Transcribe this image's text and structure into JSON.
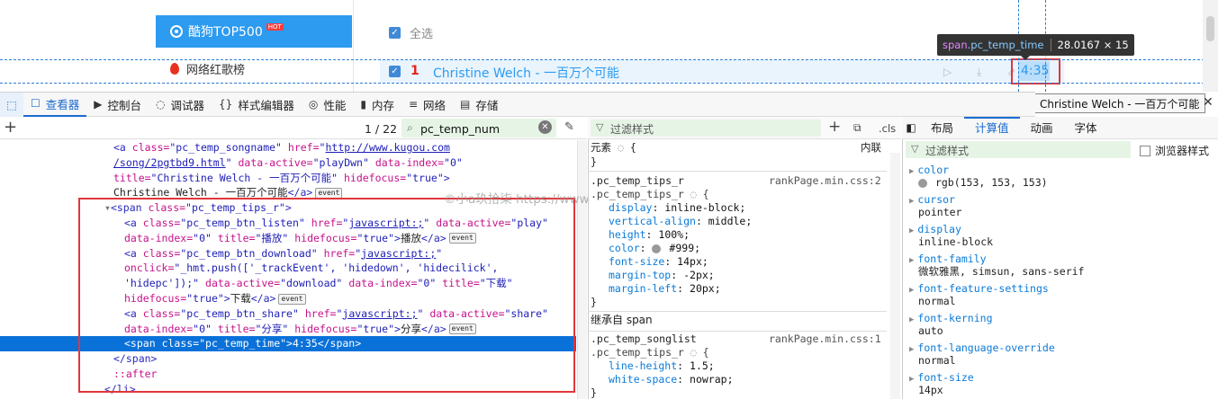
{
  "page": {
    "top500_label": "酷狗TOP500",
    "hot_badge": "HOT",
    "hotsong_label": "网络红歌榜",
    "select_all": "全选",
    "row1_num": "1",
    "row1_name": "Christine Welch - 一百万个可能",
    "row1_icons": "▷ ⤓ ⇗",
    "row1_time": "4:35",
    "tooltip_tag": "span",
    "tooltip_class": ".pc_temp_time",
    "tooltip_size": "28.0167 × 15",
    "title_tooltip": "Christine Welch - 一百万个可能",
    "close": "✕"
  },
  "toolbar": {
    "tabs": [
      {
        "icon": "☐",
        "label": "查看器"
      },
      {
        "icon": "▶",
        "label": "控制台"
      },
      {
        "icon": "◌",
        "label": "调试器"
      },
      {
        "icon": "{}",
        "label": "样式编辑器"
      },
      {
        "icon": "◎",
        "label": "性能"
      },
      {
        "icon": "▮",
        "label": "内存"
      },
      {
        "icon": "≡",
        "label": "网络"
      },
      {
        "icon": "▤",
        "label": "存储"
      }
    ]
  },
  "inspector": {
    "match_count": "1 / 22",
    "search_value": "pc_temp_num",
    "markup_lines": [
      {
        "indent": 126,
        "html": "<span class='t'>&lt;a</span> <span class='a'>class=</span><span class='v'>\"pc_temp_songname\"</span> <span class='a'>href=</span><span class='v'>\"</span><span class='u'>http://www.kugou.com</span>"
      },
      {
        "indent": 126,
        "html": "<span class='u'>/song/2pgtbd9.html</span><span class='v'>\"</span> <span class='a'>data-active=</span><span class='v'>\"playDwn\"</span> <span class='a'>data-index=</span><span class='v'>\"0\"</span>"
      },
      {
        "indent": 126,
        "html": "<span class='a'>title=</span><span class='v'>\"Christine Welch - 一百万个可能\"</span> <span class='a'>hidefocus=</span><span class='v'>\"true\"</span><span class='t'>&gt;</span>"
      },
      {
        "indent": 126,
        "html": "Christine Welch - 一百万个可能<span class='t'>&lt;/a&gt;</span><span class='ev'>event</span>"
      },
      {
        "indent": 116,
        "html": "<span style='color:#777'>▾</span><span class='t'>&lt;span</span> <span class='a'>class=</span><span class='v'>\"pc_temp_tips_r\"</span><span class='t'>&gt;</span>"
      },
      {
        "indent": 138,
        "html": "<span class='t'>&lt;a</span> <span class='a'>class=</span><span class='v'>\"pc_temp_btn_listen\"</span> <span class='a'>href=</span><span class='v'>\"</span><span class='u'>javascript:;</span><span class='v'>\"</span> <span class='a'>data-active=</span><span class='v'>\"play\"</span>"
      },
      {
        "indent": 138,
        "html": "<span class='a'>data-index=</span><span class='v'>\"0\"</span> <span class='a'>title=</span><span class='v'>\"播放\"</span> <span class='a'>hidefocus=</span><span class='v'>\"true\"</span><span class='t'>&gt;</span>播放<span class='t'>&lt;/a&gt;</span><span class='ev'>event</span>"
      },
      {
        "indent": 138,
        "html": "<span class='t'>&lt;a</span> <span class='a'>class=</span><span class='v'>\"pc_temp_btn_download\"</span> <span class='a'>href=</span><span class='v'>\"</span><span class='u'>javascript:;</span><span class='v'>\"</span>"
      },
      {
        "indent": 138,
        "html": "<span class='a'>onclick=</span><span class='v'>\"_hmt.push(['_trackEvent', 'hidedown', 'hidecilick',</span>"
      },
      {
        "indent": 138,
        "html": "<span class='v'>'hidepc']);\"</span> <span class='a'>data-active=</span><span class='v'>\"download\"</span> <span class='a'>data-index=</span><span class='v'>\"0\"</span> <span class='a'>title=</span><span class='v'>\"下载\"</span>"
      },
      {
        "indent": 138,
        "html": "<span class='a'>hidefocus=</span><span class='v'>\"true\"</span><span class='t'>&gt;</span>下载<span class='t'>&lt;/a&gt;</span><span class='ev'>event</span>"
      },
      {
        "indent": 138,
        "html": "<span class='t'>&lt;a</span> <span class='a'>class=</span><span class='v'>\"pc_temp_btn_share\"</span> <span class='a'>href=</span><span class='v'>\"</span><span class='u'>javascript:;</span><span class='v'>\"</span> <span class='a'>data-active=</span><span class='v'>\"share\"</span>"
      },
      {
        "indent": 138,
        "html": "<span class='a'>data-index=</span><span class='v'>\"0\"</span> <span class='a'>title=</span><span class='v'>\"分享\"</span> <span class='a'>hidefocus=</span><span class='v'>\"true\"</span><span class='t'>&gt;</span>分享<span class='t'>&lt;/a&gt;</span><span class='ev'>event</span>"
      },
      {
        "indent": 138,
        "selected": true,
        "html": "<span class='t'>&lt;span</span> <span class='a'>class=</span><span class='v'>\"pc_temp_time\"</span><span class='t'>&gt;</span>4:35<span class='t'>&lt;/span&gt;</span>"
      },
      {
        "indent": 126,
        "html": "<span class='t'>&lt;/span&gt;</span>"
      },
      {
        "indent": 126,
        "html": "<span class='a'>::after</span>"
      },
      {
        "indent": 116,
        "html": "<span class='t'>&lt;/li&gt;</span>"
      }
    ],
    "watermark": "©小a玖拾柒 https://www.cnblogs.com/ftl1012"
  },
  "rules": {
    "filter_placeholder": "过滤样式",
    "cls": ".cls",
    "element_label": "元素",
    "element_brace": "{",
    "inline_label": "内联",
    "close_brace": "}",
    "rule1_selector": ".pc_temp_tips_r",
    "rule1_src": "rankPage.min.css:2",
    "rule1_sub": ".pc_temp_tips_r",
    "rule1_props": [
      {
        "p": "display",
        "v": "inline-block;"
      },
      {
        "p": "vertical-align",
        "v": "middle;"
      },
      {
        "p": "height",
        "v": "100%;"
      },
      {
        "p": "color",
        "v": "#999;",
        "swatch": "#999999"
      },
      {
        "p": "font-size",
        "v": "14px;"
      },
      {
        "p": "margin-top",
        "v": "-2px;"
      },
      {
        "p": "margin-left",
        "v": "20px;"
      }
    ],
    "inherit_label": "继承自 span",
    "rule2_selector": ".pc_temp_songlist",
    "rule2_src": "rankPage.min.css:1",
    "rule2_sub": ".pc_temp_tips_r",
    "rule2_props": [
      {
        "p": "line-height",
        "v": "1.5;"
      },
      {
        "p": "white-space",
        "v": "nowrap;"
      }
    ]
  },
  "computed": {
    "tabs": [
      "布局",
      "计算值",
      "动画",
      "字体"
    ],
    "selected_tab": "计算值",
    "filter_placeholder": "过滤样式",
    "browser_styles": "浏览器样式",
    "props": [
      {
        "p": "color",
        "v": "rgb(153, 153, 153)",
        "swatch": "#999999"
      },
      {
        "p": "cursor",
        "v": "pointer"
      },
      {
        "p": "display",
        "v": "inline-block"
      },
      {
        "p": "font-family",
        "v": "微软雅黑, simsun, sans-serif"
      },
      {
        "p": "font-feature-settings",
        "v": "normal"
      },
      {
        "p": "font-kerning",
        "v": "auto"
      },
      {
        "p": "font-language-override",
        "v": "normal"
      },
      {
        "p": "font-size",
        "v": "14px"
      }
    ]
  },
  "colors": {
    "accent": "#1a6bd0",
    "kugou_blue": "#2c9bf0",
    "highlight_red": "#e0363a",
    "selected_row": "#0a71d9"
  }
}
